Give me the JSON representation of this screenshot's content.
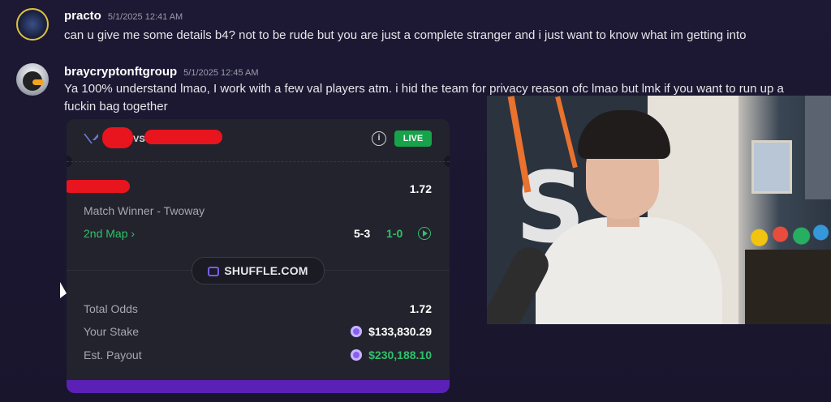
{
  "messages": [
    {
      "username": "practo",
      "timestamp": "5/1/2025 12:41 AM",
      "text": "can u give me some details b4? not to be rude but you are just a complete stranger and i just want to know what im getting into"
    },
    {
      "username": "braycryptonftgroup",
      "timestamp": "5/1/2025 12:45 AM",
      "text_line1": "Ya 100% understand lmao, I work with a few val players atm. i hid the team for privacy reason ofc lmao but lmk if you want to run up a",
      "text_line2": "fuckin bag together"
    }
  ],
  "bet_card": {
    "vs_label": "VS",
    "info_icon": "info-icon",
    "live_badge": "LIVE",
    "selection_odds": "1.72",
    "market": "Match Winner - Twoway",
    "map_link": "2nd Map ›",
    "score_rounds": "5-3",
    "score_maps": "1-0",
    "brand": "SHUFFLE.COM",
    "total_odds_label": "Total Odds",
    "total_odds_value": "1.72",
    "stake_label": "Your Stake",
    "stake_value": "$133,830.29",
    "payout_label": "Est. Payout",
    "payout_value": "$230,188.10",
    "colors": {
      "live": "#16a34a",
      "green": "#2ec26a",
      "accent": "#5b21b6",
      "redaction": "#e8141e"
    }
  },
  "webcam": {
    "sign_letter": "S"
  }
}
